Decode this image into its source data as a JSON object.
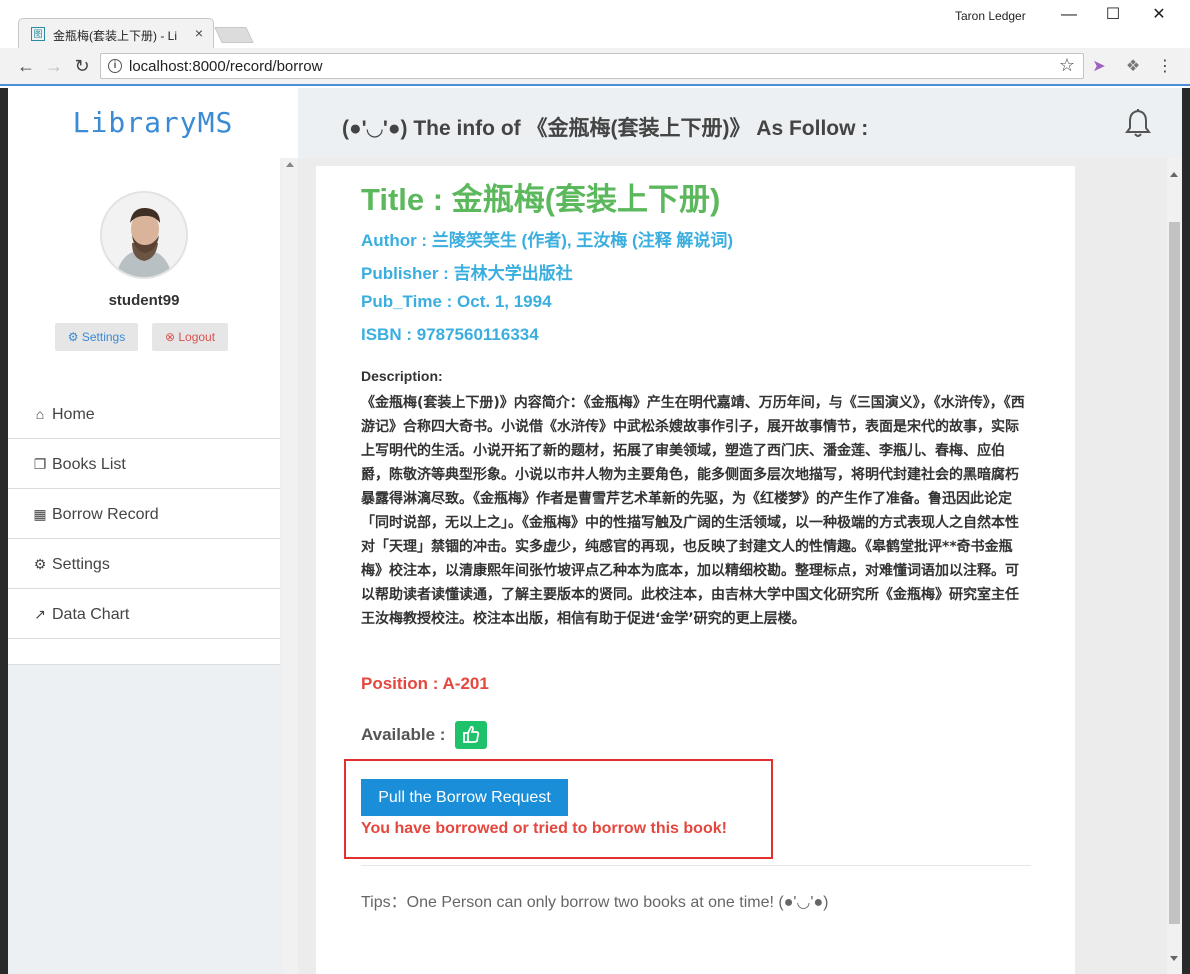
{
  "browser": {
    "tab_title": "金瓶梅(套装上下册) - Li",
    "tab_favicon": "图",
    "close_symbol": "×",
    "user_name": "Taron Ledger",
    "url": "localhost:8000/record/borrow",
    "window_buttons": {
      "minimize": "—",
      "maximize": "☐",
      "close": "✕"
    },
    "nav": {
      "back": "←",
      "forward": "→",
      "reload": "↻"
    }
  },
  "sidebar": {
    "brand": "LibraryMS",
    "username": "student99",
    "settings_button": "⚙ Settings",
    "logout_button": "⊗ Logout",
    "menu": [
      {
        "icon": "home-icon",
        "glyph": "⌂",
        "label": "Home"
      },
      {
        "icon": "books-icon",
        "glyph": "❐",
        "label": "Books List"
      },
      {
        "icon": "table-icon",
        "glyph": "▦",
        "label": "Borrow Record"
      },
      {
        "icon": "gear-icon",
        "glyph": "⚙",
        "label": "Settings"
      },
      {
        "icon": "chart-icon",
        "glyph": "↗",
        "label": "Data Chart"
      }
    ]
  },
  "header": {
    "title": "(●'◡'●) The info of 《金瓶梅(套装上下册)》 As Follow :"
  },
  "book": {
    "title": "Title : 金瓶梅(套装上下册)",
    "author": "Author : 兰陵笑笑生 (作者), 王汝梅 (注释 解说词)",
    "publisher": "Publisher : 吉林大学出版社",
    "pub_time": "Pub_Time : Oct. 1, 1994",
    "isbn": "ISBN : 9787560116334",
    "description_label": "Description:",
    "description": "《金瓶梅(套装上下册)》内容简介：《金瓶梅》产生在明代嘉靖、万历年间，与《三国演义》，《水浒传》，《西游记》合称四大奇书。小说借《水浒传》中武松杀嫂故事作引子，展开故事情节，表面是宋代的故事，实际上写明代的生活。小说开拓了新的题材，拓展了审美领域，塑造了西门庆、潘金莲、李瓶儿、春梅、应伯爵，陈敬济等典型形象。小说以市井人物为主要角色，能多侧面多层次地描写，将明代封建社会的黑暗腐朽暴露得淋漓尽致。《金瓶梅》作者是曹雪芹艺术革新的先驱，为《红楼梦》的产生作了准备。鲁迅因此论定「同时说部，无以上之」。《金瓶梅》中的性描写触及广阔的生活领域，以一种极端的方式表现人之自然本性对「天理」禁锢的冲击。实多虚少，纯感官的再现，也反映了封建文人的性情趣。《皋鹤堂批评**奇书金瓶梅》校注本，以清康熙年间张竹坡评点乙种本为底本，加以精细校勘。整理标点，对难懂词语加以注释。可以帮助读者读懂读通，了解主要版本的贤同。此校注本，由吉林大学中国文化研究所《金瓶梅》研究室主任王汝梅教授校注。校注本出版，相信有助于促进‘金学’研究的更上层楼。",
    "position": "Position : A-201",
    "available_label": "Available :",
    "available": true
  },
  "actions": {
    "borrow_button": "Pull the Borrow Request",
    "borrow_message": "You have borrowed or tried to borrow this book!",
    "tips": "Tips：One Person can only borrow two books at one time! (●'◡'●)"
  },
  "colors": {
    "brand": "#3a8ad4",
    "title_green": "#5cb85c",
    "meta_blue": "#3aaede",
    "alert_red": "#e4473e",
    "button_blue": "#1a8ed8",
    "available_green": "#1ec26a"
  }
}
